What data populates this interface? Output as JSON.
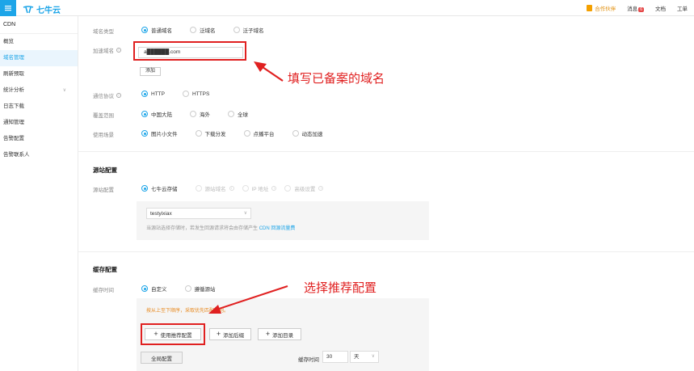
{
  "topbar": {
    "brand": "七牛云",
    "partner": "合作伙伴",
    "messages": "消息",
    "message_count": "6",
    "docs": "文档",
    "tickets": "工单"
  },
  "sidebar": {
    "title": "CDN",
    "items": [
      {
        "label": "概览"
      },
      {
        "label": "域名管理"
      },
      {
        "label": "刷新预取"
      },
      {
        "label": "统计分析"
      },
      {
        "label": "日志下载"
      },
      {
        "label": "通知管理"
      },
      {
        "label": "告警配置"
      },
      {
        "label": "告警联系人"
      }
    ]
  },
  "form": {
    "domain_type": {
      "label": "域名类型",
      "options": [
        "普通域名",
        "泛域名",
        "泛子域名"
      ]
    },
    "accel_domain": {
      "label": "加速域名",
      "value": "a██████.com",
      "add_button": "添加"
    },
    "protocol": {
      "label": "通信协议",
      "options": [
        "HTTP",
        "HTTPS"
      ]
    },
    "coverage": {
      "label": "覆盖范围",
      "options": [
        "中国大陆",
        "海外",
        "全球"
      ]
    },
    "scenario": {
      "label": "使用场景",
      "options": [
        "图片小文件",
        "下载分发",
        "点播平台",
        "动态加速"
      ]
    }
  },
  "origin": {
    "section_title": "源站配置",
    "label": "源站配置",
    "options": [
      "七牛云存储",
      "源站域名",
      "IP 地址",
      "高级设置"
    ],
    "bucket_value": "testyixiax",
    "note_prefix": "当源站选择存储时，若发生回源请求将会由存储产生",
    "note_link": "CDN 回源流量费"
  },
  "cache": {
    "section_title": "缓存配置",
    "label": "缓存时间",
    "options": [
      "自定义",
      "遵循源站"
    ],
    "order_note": "按从上至下顺序，采取优先匹配原则。",
    "btn_recommend": "使用推荐配置",
    "btn_add_suffix": "添加后缀",
    "btn_add_dir": "添加目录",
    "global_config": "全局配置",
    "cache_time_label": "缓存时间",
    "cache_time_value": "30",
    "cache_time_unit": "天"
  },
  "annotations": {
    "fill_domain": "填写已备案的域名",
    "choose_recommend": "选择推荐配置"
  },
  "colors": {
    "accent": "#1da5e8",
    "annotation_red": "#e02020",
    "warning_orange": "#e8891e"
  }
}
